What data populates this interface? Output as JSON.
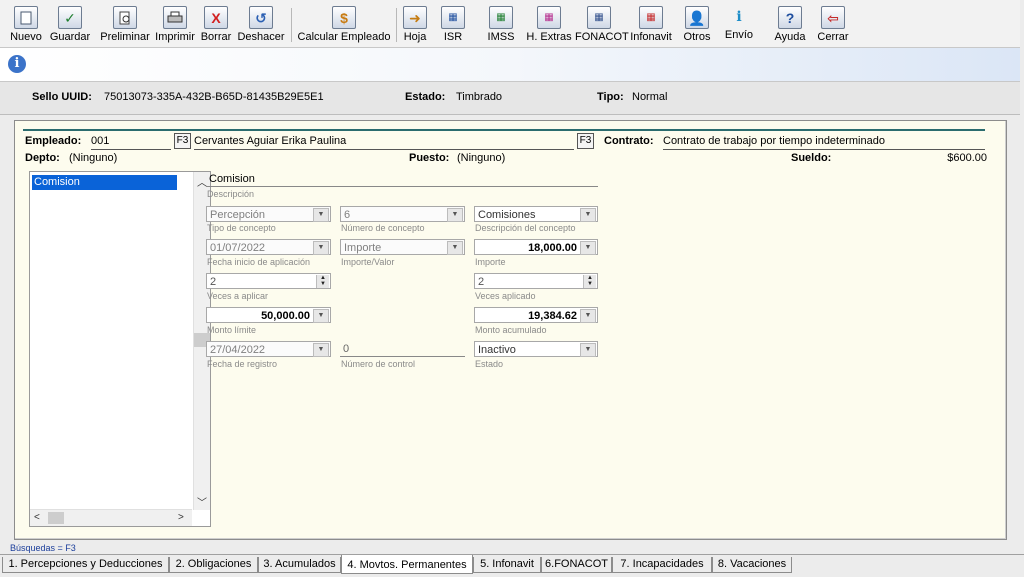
{
  "toolbar": {
    "nuevo": "Nuevo",
    "guardar": "Guardar",
    "preliminar": "Preliminar",
    "imprimir": "Imprimir",
    "borrar": "Borrar",
    "deshacer": "Deshacer",
    "calcular": "Calcular Empleado",
    "hoja": "Hoja",
    "isr": "ISR",
    "imss": "IMSS",
    "hextras": "H. Extras",
    "fonacot": "FONACOT",
    "infonavit": "Infonavit",
    "otros": "Otros",
    "envio": "Envío",
    "ayuda": "Ayuda",
    "cerrar": "Cerrar"
  },
  "header": {
    "sello_label": "Sello UUID:",
    "sello_value": "75013073-335A-432B-B65D-81435B29E5E1",
    "estado_label": "Estado:",
    "estado_value": "Timbrado",
    "tipo_label": "Tipo:",
    "tipo_value": "Normal"
  },
  "employee": {
    "empleado_label": "Empleado:",
    "empleado_num": "001",
    "f3": "F3",
    "empleado_name": "Cervantes Aguiar Erika Paulina",
    "contrato_label": "Contrato:",
    "contrato_value": "Contrato de trabajo por tiempo indeterminado",
    "depto_label": "Depto:",
    "depto_value": "(Ninguno)",
    "puesto_label": "Puesto:",
    "puesto_value": "(Ninguno)",
    "sueldo_label": "Sueldo:",
    "sueldo_value": "$600.00"
  },
  "list": {
    "items": [
      "Comision"
    ]
  },
  "form": {
    "descripcion": {
      "value": "Comision",
      "caption": "Descripción"
    },
    "tipo_concepto": {
      "value": "Percepción",
      "caption": "Tipo de concepto"
    },
    "numero_concepto": {
      "value": "6",
      "caption": "Número de concepto"
    },
    "desc_concepto": {
      "value": "Comisiones",
      "caption": "Descripción del concepto"
    },
    "fecha_inicio": {
      "value": "01/07/2022",
      "caption": "Fecha inicio de aplicación"
    },
    "importe_valor": {
      "value": "Importe",
      "caption": "Importe/Valor"
    },
    "importe": {
      "value": "18,000.00",
      "caption": "Importe"
    },
    "veces_aplicar": {
      "value": "2",
      "caption": "Veces a aplicar"
    },
    "veces_aplicado": {
      "value": "2",
      "caption": "Veces aplicado"
    },
    "monto_limite": {
      "value": "50,000.00",
      "caption": "Monto límite"
    },
    "monto_acumulado": {
      "value": "19,384.62",
      "caption": "Monto acumulado"
    },
    "fecha_registro": {
      "value": "27/04/2022",
      "caption": "Fecha de registro"
    },
    "numero_control": {
      "value": "0",
      "caption": "Número de control"
    },
    "estado": {
      "value": "Inactivo",
      "caption": "Estado"
    }
  },
  "footer": {
    "busquedas": "Búsquedas = F3",
    "tabs": [
      "1. Percepciones y Deducciones",
      "2. Obligaciones",
      "3. Acumulados",
      "4. Movtos. Permanentes",
      "5. Infonavit",
      "6.FONACOT",
      "7. Incapacidades",
      "8. Vacaciones"
    ],
    "active_tab": 3
  },
  "icons": {
    "nuevo": "new-document-icon",
    "guardar": "checkmark-icon",
    "preliminar": "print-preview-icon",
    "imprimir": "printer-icon",
    "borrar": "delete-x-icon",
    "deshacer": "undo-icon",
    "calcular": "calculate-icon",
    "info": "info-icon"
  }
}
